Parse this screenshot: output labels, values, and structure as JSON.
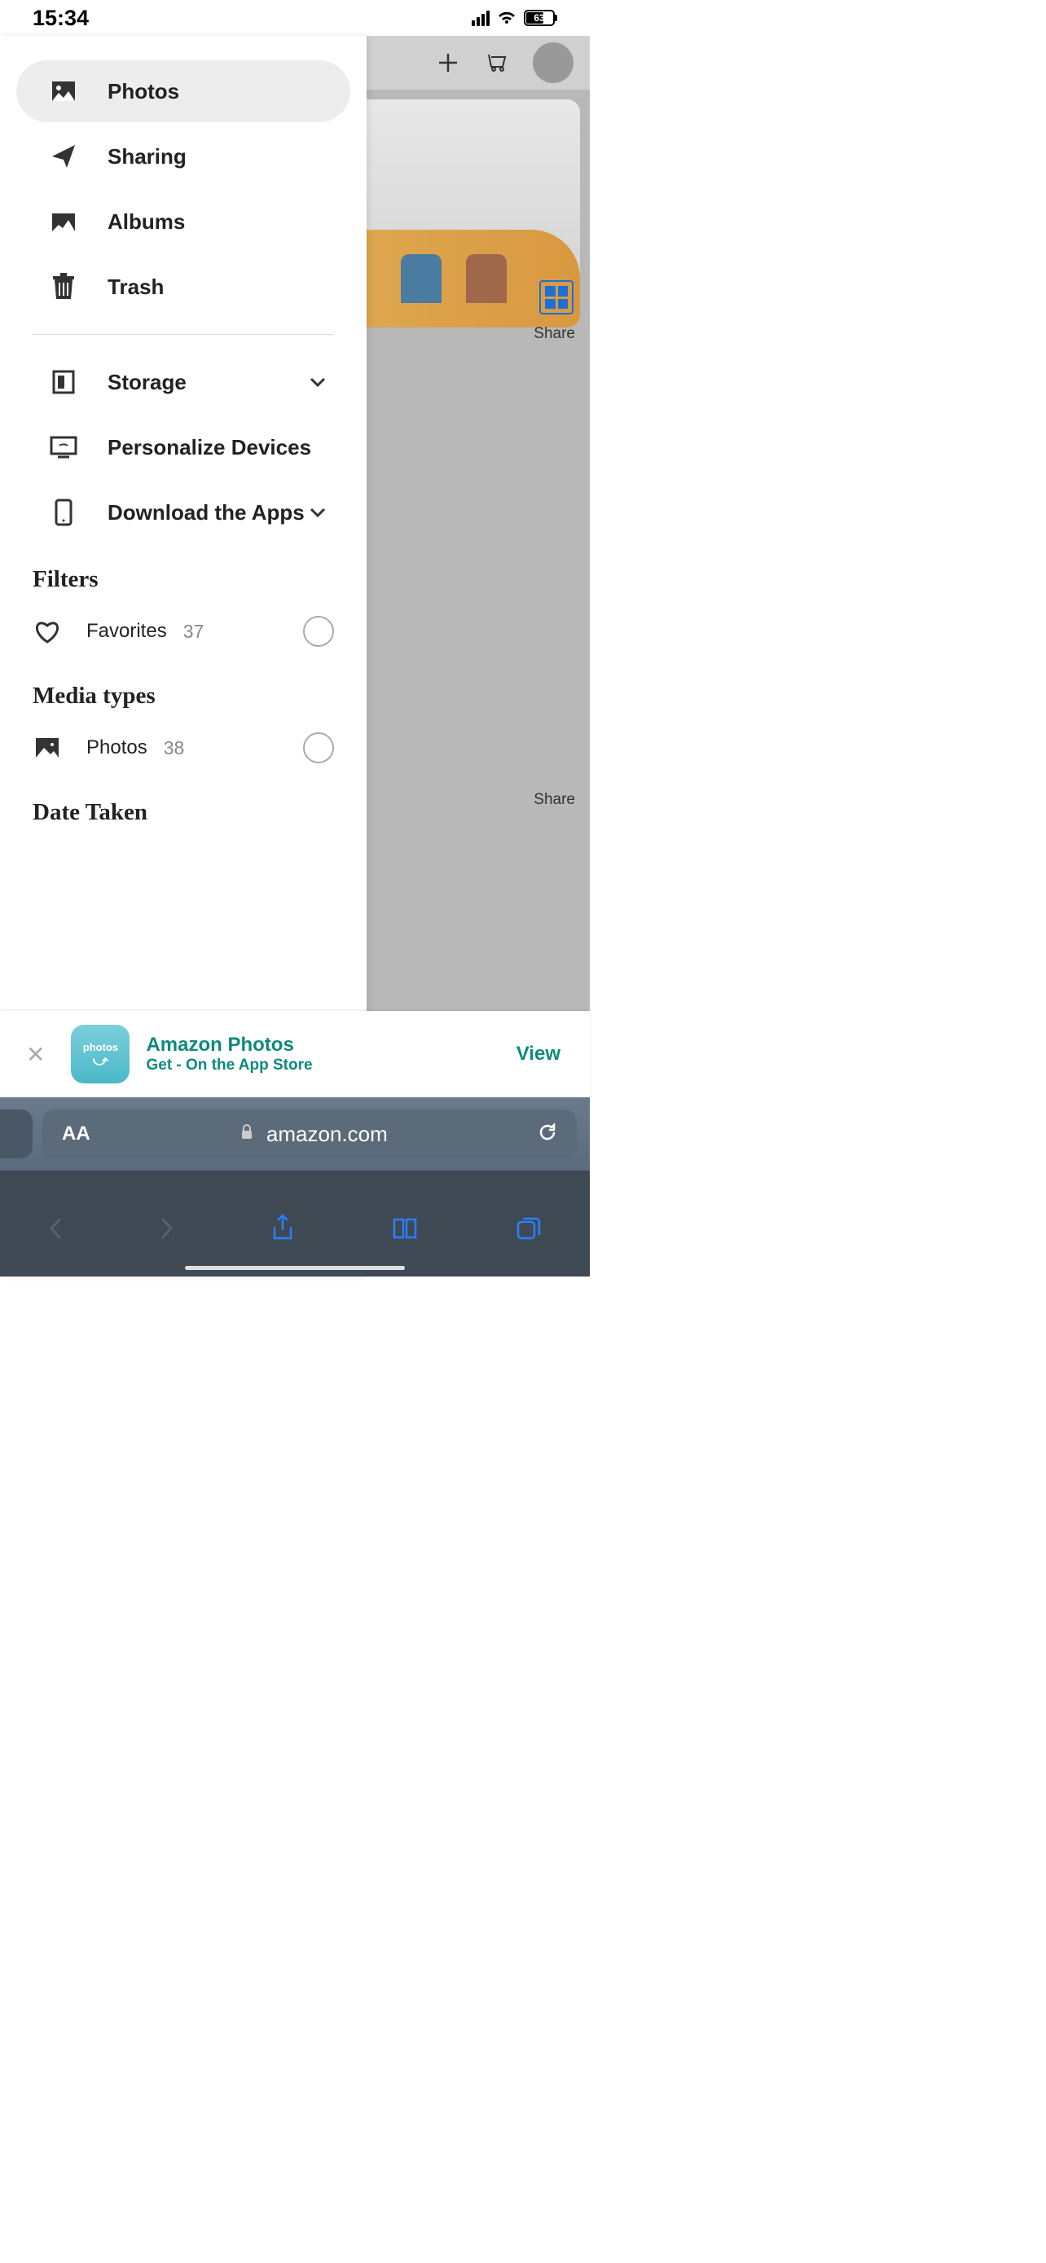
{
  "status": {
    "time": "15:34",
    "battery": "63"
  },
  "sidebar": {
    "photos": "Photos",
    "sharing": "Sharing",
    "albums": "Albums",
    "trash": "Trash",
    "storage": "Storage",
    "personalize": "Personalize Devices",
    "download": "Download the Apps"
  },
  "filters": {
    "title": "Filters",
    "favorites_label": "Favorites",
    "favorites_count": "37",
    "media_title": "Media types",
    "photos_label": "Photos",
    "photos_count": "38",
    "date_title": "Date Taken"
  },
  "background": {
    "share": "Share",
    "share2": "Share"
  },
  "banner": {
    "icon_text": "photos",
    "title": "Amazon Photos",
    "subtitle": "Get - On the App Store",
    "action": "View"
  },
  "url": {
    "domain": "amazon.com"
  }
}
